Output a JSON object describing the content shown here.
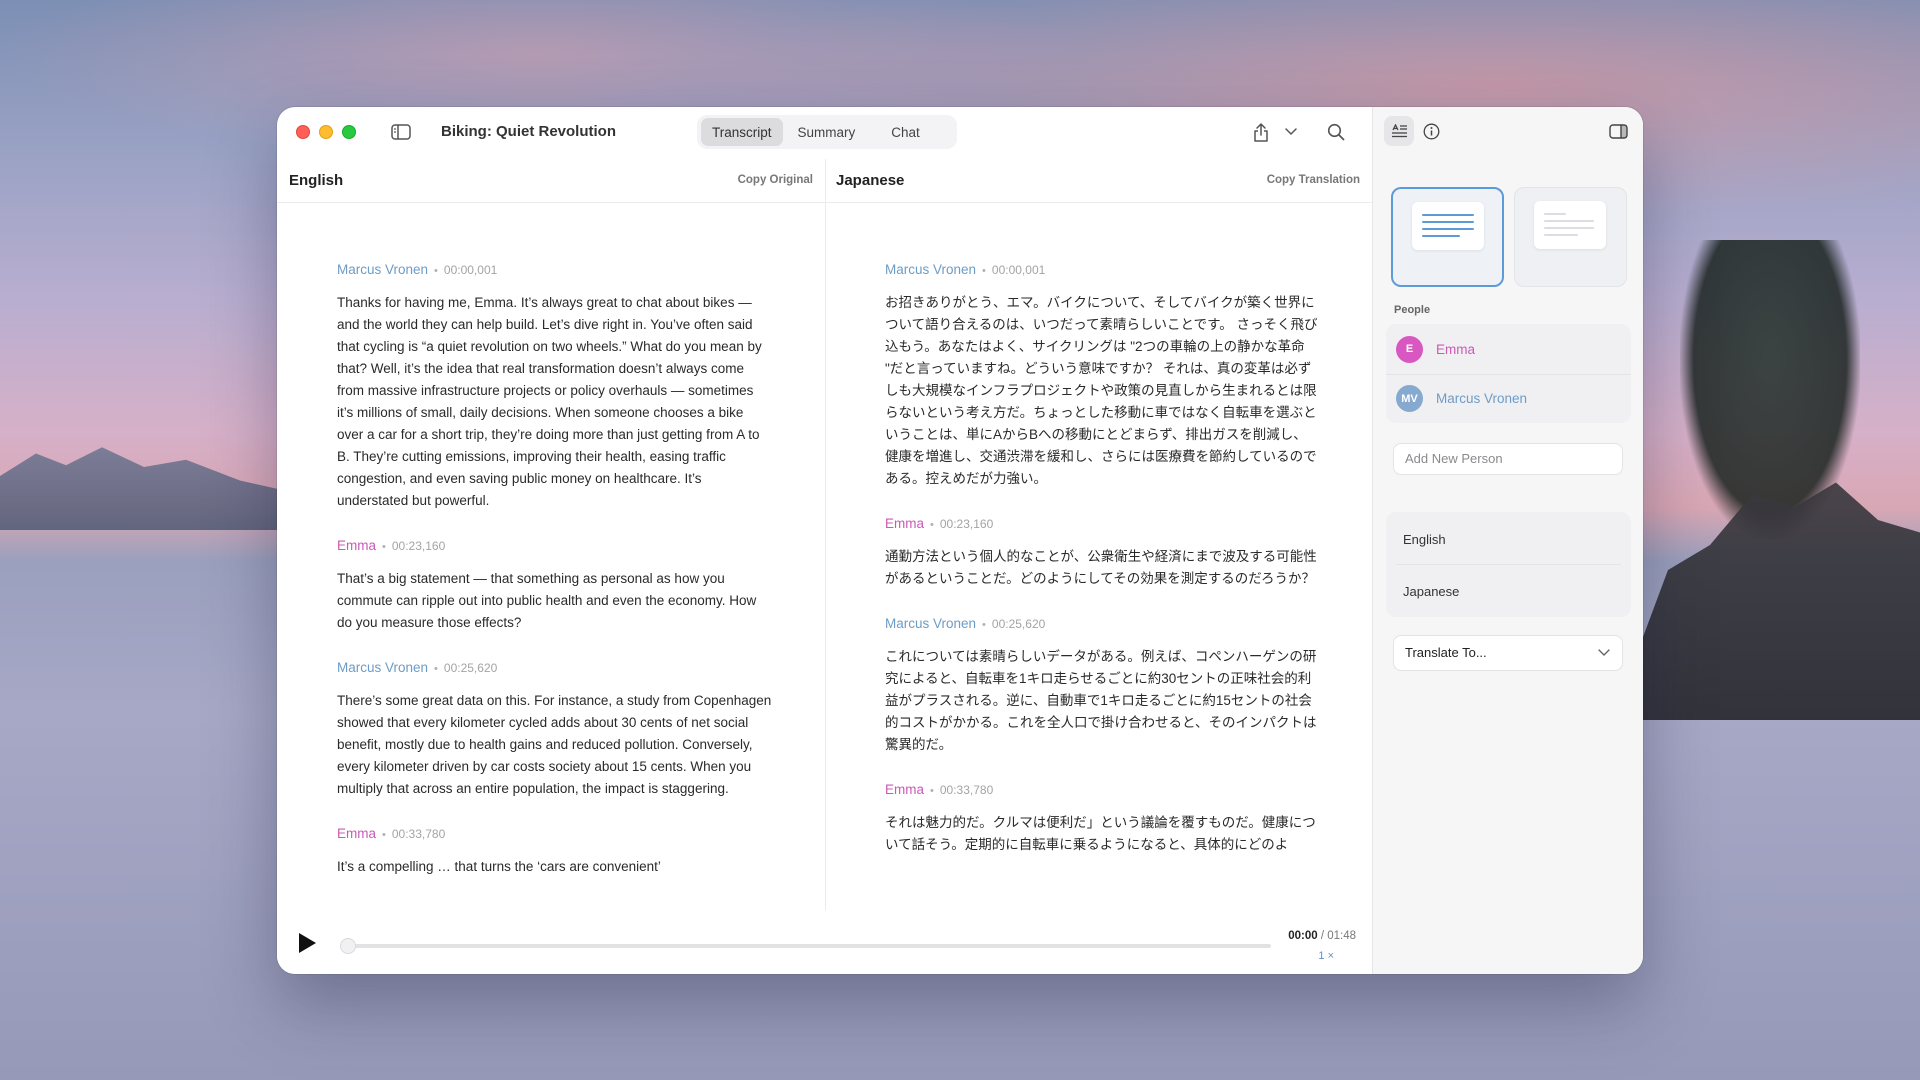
{
  "window": {
    "title": "Biking: Quiet Revolution"
  },
  "tabs": [
    {
      "label": "Transcript",
      "active": true
    },
    {
      "label": "Summary",
      "active": false
    },
    {
      "label": "Chat",
      "active": false
    }
  ],
  "original": {
    "language": "English",
    "copy_label": "Copy Original",
    "entries": [
      {
        "speaker": "Marcus Vronen",
        "time": "00:00,001",
        "text": "Thanks for having me, Emma. It’s always great to chat about bikes — and the world they can help build. Let’s dive right in. You’ve often said that cycling is “a quiet revolution on two wheels.” What do you mean by that? Well, it’s the idea that real transformation doesn’t always come from massive infrastructure projects or policy overhauls — sometimes it’s millions of small, daily decisions. When someone chooses a bike over a car for a short trip, they’re doing more than just getting from A to B. They’re cutting emissions, improving their health, easing traffic congestion, and even saving public money on healthcare. It’s understated but powerful."
      },
      {
        "speaker": "Emma",
        "time": "00:23,160",
        "text": "That’s a big statement — that something as personal as how you commute can ripple out into public health and even the economy. How do you measure those effects?"
      },
      {
        "speaker": "Marcus Vronen",
        "time": "00:25,620",
        "text": "There’s some great data on this. For instance, a study from Copenhagen showed that every kilometer cycled adds about 30 cents of net social benefit, mostly due to health gains and reduced pollution. Conversely, every kilometer driven by car costs society about 15 cents. When you multiply that across an entire population, the impact is staggering."
      },
      {
        "speaker": "Emma",
        "time": "00:33,780",
        "text": "It’s a compelling … that turns the ‘cars are convenient’"
      }
    ]
  },
  "translation": {
    "language": "Japanese",
    "copy_label": "Copy Translation",
    "entries": [
      {
        "speaker": "Marcus Vronen",
        "time": "00:00,001",
        "text": "お招きありがとう、エマ。バイクについて、そしてバイクが築く世界について語り合えるのは、いつだって素晴らしいことです。 さっそく飛び込もう。あなたはよく、サイクリングは \"2つの車輪の上の静かな革命 \"だと言っていますね。どういう意味ですか？ それは、真の変革は必ずしも大規模なインフラプロジェクトや政策の見直しから生まれるとは限らないという考え方だ。ちょっとした移動に車ではなく自転車を選ぶということは、単にAからBへの移動にとどまらず、排出ガスを削減し、健康を増進し、交通渋滞を緩和し、さらには医療費を節約しているのである。控えめだが力強い。"
      },
      {
        "speaker": "Emma",
        "time": "00:23,160",
        "text": "通勤方法という個人的なことが、公衆衛生や経済にまで波及する可能性があるということだ。どのようにしてその効果を測定するのだろうか？"
      },
      {
        "speaker": "Marcus Vronen",
        "time": "00:25,620",
        "text": "これについては素晴らしいデータがある。例えば、コペンハーゲンの研究によると、自転車を1キロ走らせるごとに約30セントの正味社会的利益がプラスされる。逆に、自動車で1キロ走るごとに約15セントの社会的コストがかかる。これを全人口で掛け合わせると、そのインパクトは驚異的だ。"
      },
      {
        "speaker": "Emma",
        "time": "00:33,780",
        "text": "それは魅力的だ。クルマは便利だ」という議論を覆すものだ。健康について話そう。定期的に自転車に乗るようになると、具体的にどのよ"
      }
    ]
  },
  "player": {
    "current": "00:00",
    "separator": " / ",
    "total": "01:48",
    "speed": "1 ×",
    "progress": 0.0
  },
  "sidebar": {
    "people_label": "People",
    "people": [
      {
        "name": "Emma",
        "initials": "E",
        "color": "#d957c0"
      },
      {
        "name": "Marcus Vronen",
        "initials": "MV",
        "color": "#86a9cf"
      }
    ],
    "add_person_placeholder": "Add New Person",
    "languages": [
      "English",
      "Japanese"
    ],
    "translate_label": "Translate To..."
  },
  "colors": {
    "accent": "#5d9bd6",
    "marcus": "#6d9cc6",
    "emma": "#cc59b6"
  }
}
